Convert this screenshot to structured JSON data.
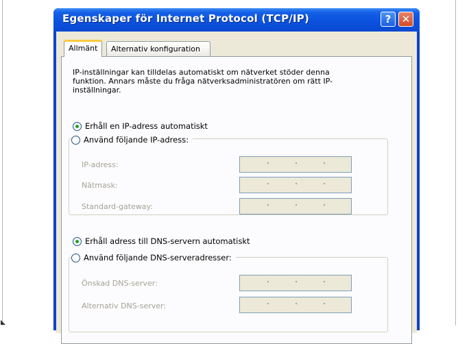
{
  "window": {
    "title": "Egenskaper för Internet Protocol (TCP/IP)",
    "help_glyph": "?",
    "close_glyph": "✕"
  },
  "tabs": [
    {
      "label": "Allmänt",
      "selected": true
    },
    {
      "label": "Alternativ konfiguration",
      "selected": false
    }
  ],
  "intro_text": "IP-inställningar kan tilldelas automatiskt om nätverket stöder denna funktion. Annars måste du fråga nätverksadministratören om rätt IP-inställningar.",
  "ip_section": {
    "auto_label": "Erhåll en IP-adress automatiskt",
    "auto_selected": true,
    "manual_label": "Använd följande IP-adress:",
    "manual_selected": false,
    "fields": [
      {
        "label": "IP-adress:",
        "value": ""
      },
      {
        "label": "Nätmask:",
        "value": ""
      },
      {
        "label": "Standard-gateway:",
        "value": ""
      }
    ]
  },
  "dns_section": {
    "auto_label": "Erhåll adress till DNS-servern automatiskt",
    "auto_selected": true,
    "manual_label": "Använd följande DNS-serveradresser:",
    "manual_selected": false,
    "fields": [
      {
        "label": "Önskad DNS-server:",
        "value": ""
      },
      {
        "label": "Alternativ DNS-server:",
        "value": ""
      }
    ]
  },
  "colors": {
    "titlebar": "#0b52de",
    "dialog_bg": "#ece9d8",
    "panel_bg": "#fcfcfe",
    "disabled_text": "#a4a194",
    "radio_dot": "#21a121",
    "close_button": "#d24a22"
  },
  "icons": [
    "help-icon",
    "close-icon",
    "radio-selected-icon",
    "radio-unselected-icon"
  ]
}
